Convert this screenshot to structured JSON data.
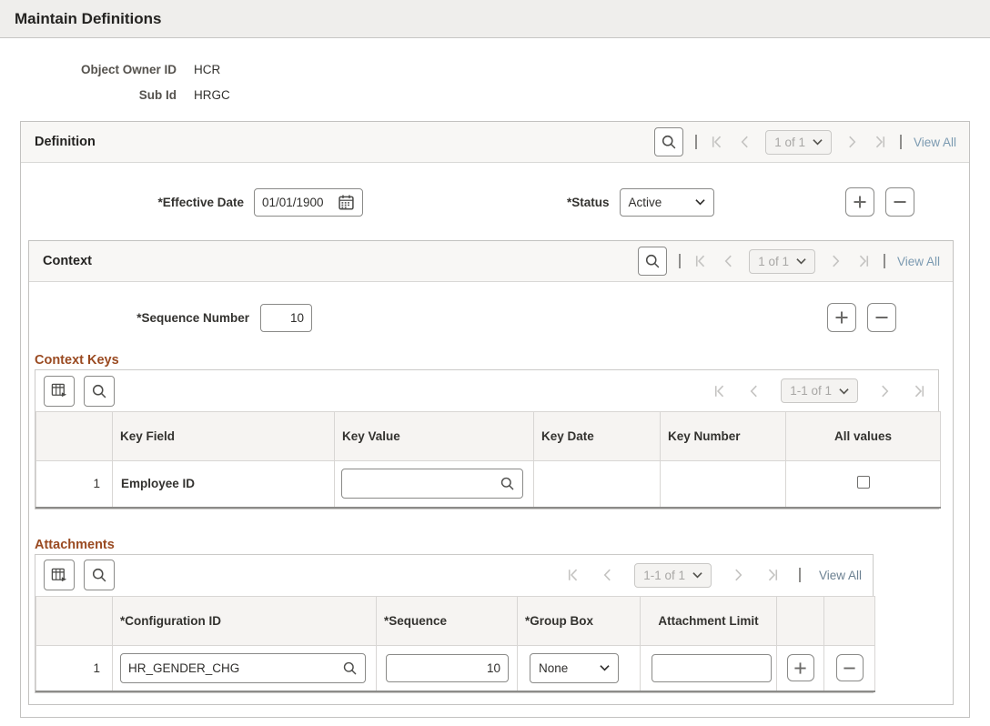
{
  "page": {
    "title": "Maintain Definitions"
  },
  "info": {
    "fields": [
      {
        "label": "Object Owner ID",
        "value": "HCR"
      },
      {
        "label": "Sub Id",
        "value": "HRGC"
      }
    ]
  },
  "definition": {
    "title": "Definition",
    "pager": {
      "page_label": "1 of 1",
      "view_all": "View All"
    },
    "effective_date": {
      "label": "*Effective Date",
      "value": "01/01/1900"
    },
    "status": {
      "label": "*Status",
      "value": "Active"
    }
  },
  "context": {
    "title": "Context",
    "pager": {
      "page_label": "1 of 1",
      "view_all": "View All"
    },
    "sequence_number": {
      "label": "*Sequence Number",
      "value": "10"
    }
  },
  "context_keys": {
    "title": "Context Keys",
    "pager": {
      "page_label": "1-1 of 1"
    },
    "columns": {
      "row": "",
      "key_field": "Key Field",
      "key_value": "Key Value",
      "key_date": "Key Date",
      "key_number": "Key Number",
      "all_values": "All values"
    },
    "rows": [
      {
        "num": "1",
        "key_field": "Employee ID",
        "key_value": "",
        "key_date": "",
        "key_number": "",
        "all_values_checked": false
      }
    ]
  },
  "attachments": {
    "title": "Attachments",
    "pager": {
      "page_label": "1-1 of 1",
      "view_all": "View All"
    },
    "columns": {
      "row": "",
      "configuration_id": "*Configuration ID",
      "sequence": "*Sequence",
      "group_box": "*Group Box",
      "attachment_limit": "Attachment Limit"
    },
    "rows": [
      {
        "num": "1",
        "configuration_id": "HR_GENDER_CHG",
        "sequence": "10",
        "group_box": "None",
        "attachment_limit": ""
      }
    ]
  },
  "colors": {
    "accent_brown": "#9a4a21",
    "link_blue": "#7b9ab1",
    "header_bg": "#f8f7f5",
    "topbar_bg": "#efeeec"
  }
}
